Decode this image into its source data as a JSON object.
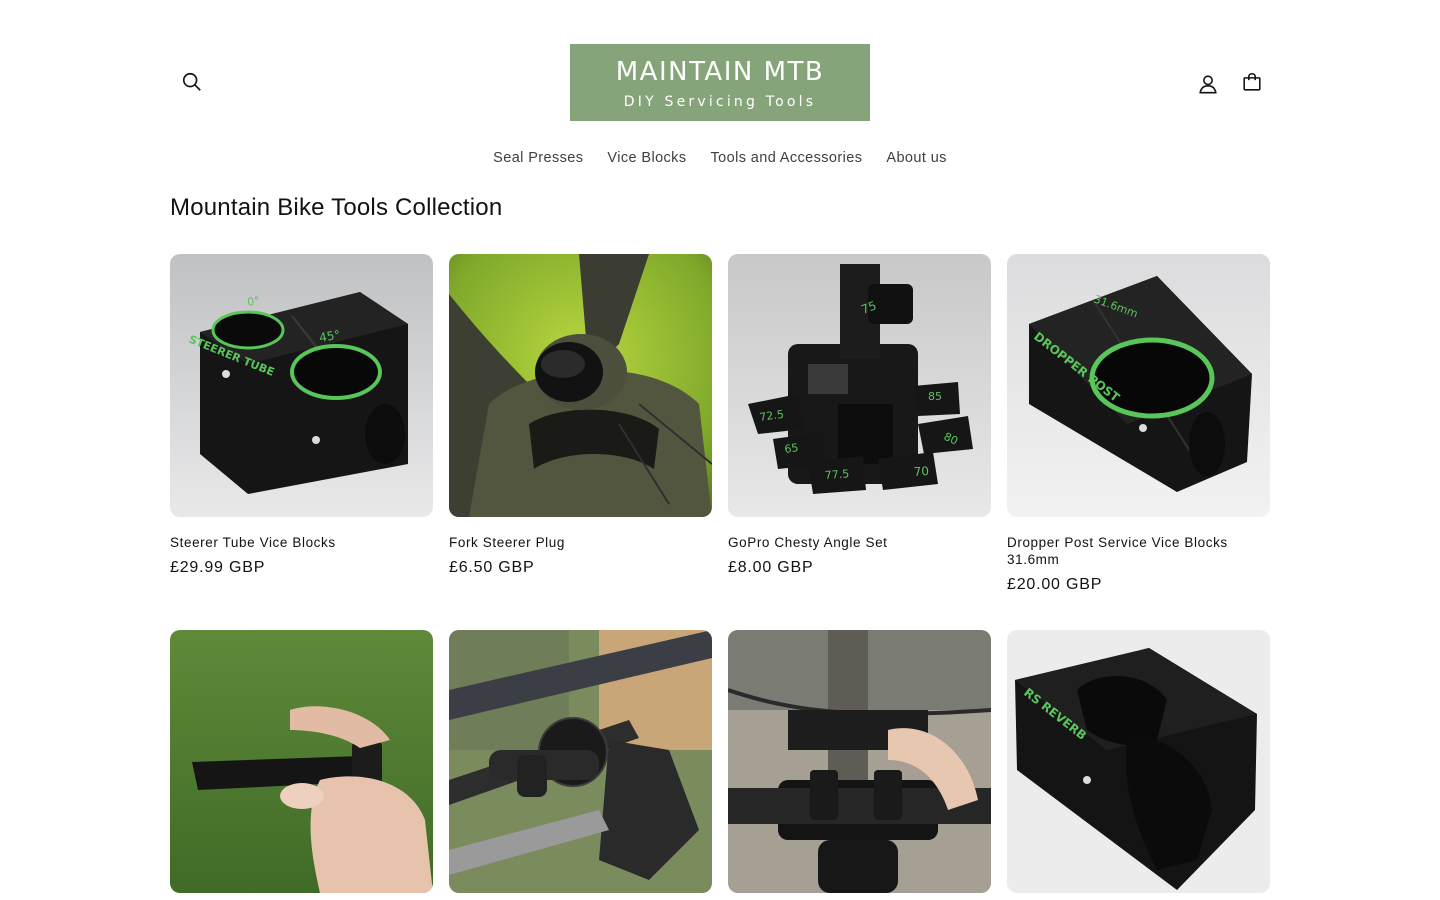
{
  "header": {
    "logo_title": "MAINTAIN MTB",
    "logo_subtitle": "DIY Servicing Tools",
    "logo_color": "#86a479",
    "icons": [
      "search-icon",
      "account-icon",
      "cart-icon"
    ]
  },
  "nav": {
    "items": [
      {
        "label": "Seal Presses"
      },
      {
        "label": "Vice Blocks"
      },
      {
        "label": "Tools and Accessories"
      },
      {
        "label": "About us"
      }
    ]
  },
  "collection": {
    "title": "Mountain Bike Tools Collection",
    "products": [
      {
        "title": "Steerer Tube Vice Blocks",
        "price": "£29.99 GBP",
        "image_text": [
          "0°",
          "45°",
          "STEERER TUBE"
        ]
      },
      {
        "title": "Fork Steerer Plug",
        "price": "£6.50 GBP"
      },
      {
        "title": "GoPro Chesty Angle Set",
        "price": "£8.00 GBP",
        "image_text": [
          "75",
          "72.5",
          "65",
          "77.5",
          "70",
          "85",
          "80"
        ]
      },
      {
        "title": "Dropper Post Service Vice Blocks 31.6mm",
        "price": "£20.00 GBP",
        "image_text": [
          "31.6mm",
          "DROPPER POST"
        ]
      },
      {
        "title": "",
        "price": ""
      },
      {
        "title": "",
        "price": ""
      },
      {
        "title": "",
        "price": ""
      },
      {
        "title": "",
        "price": "",
        "image_text": [
          "RS REVERB"
        ]
      }
    ]
  }
}
